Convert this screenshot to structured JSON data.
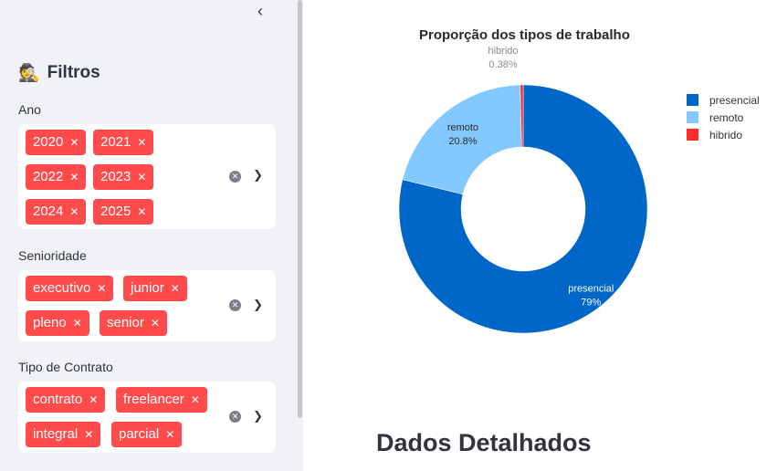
{
  "sidebar": {
    "collapse_icon": "chevron-left-icon",
    "title": "Filtros",
    "title_emoji": "🕵️",
    "filters": [
      {
        "label": "Ano",
        "tags": [
          "2020",
          "2021",
          "2022",
          "2023",
          "2024",
          "2025"
        ]
      },
      {
        "label": "Senioridade",
        "tags": [
          "executivo",
          "junior",
          "pleno",
          "senior"
        ]
      },
      {
        "label": "Tipo de Contrato",
        "tags": [
          "contrato",
          "freelancer",
          "integral",
          "parcial"
        ]
      }
    ]
  },
  "main": {
    "section_title": "Dados Detalhados"
  },
  "chart_data": {
    "type": "pie",
    "hole": true,
    "title": "Proporção dos tipos de trabalho",
    "categories": [
      "presencial",
      "remoto",
      "hibrido"
    ],
    "values": [
      78.82,
      20.8,
      0.38
    ],
    "labels_text": [
      "79%",
      "20.8%",
      "0.38%"
    ],
    "colors": [
      "#0066c8",
      "#83c9ff",
      "#ff2b2b"
    ],
    "legend_position": "top-right"
  }
}
